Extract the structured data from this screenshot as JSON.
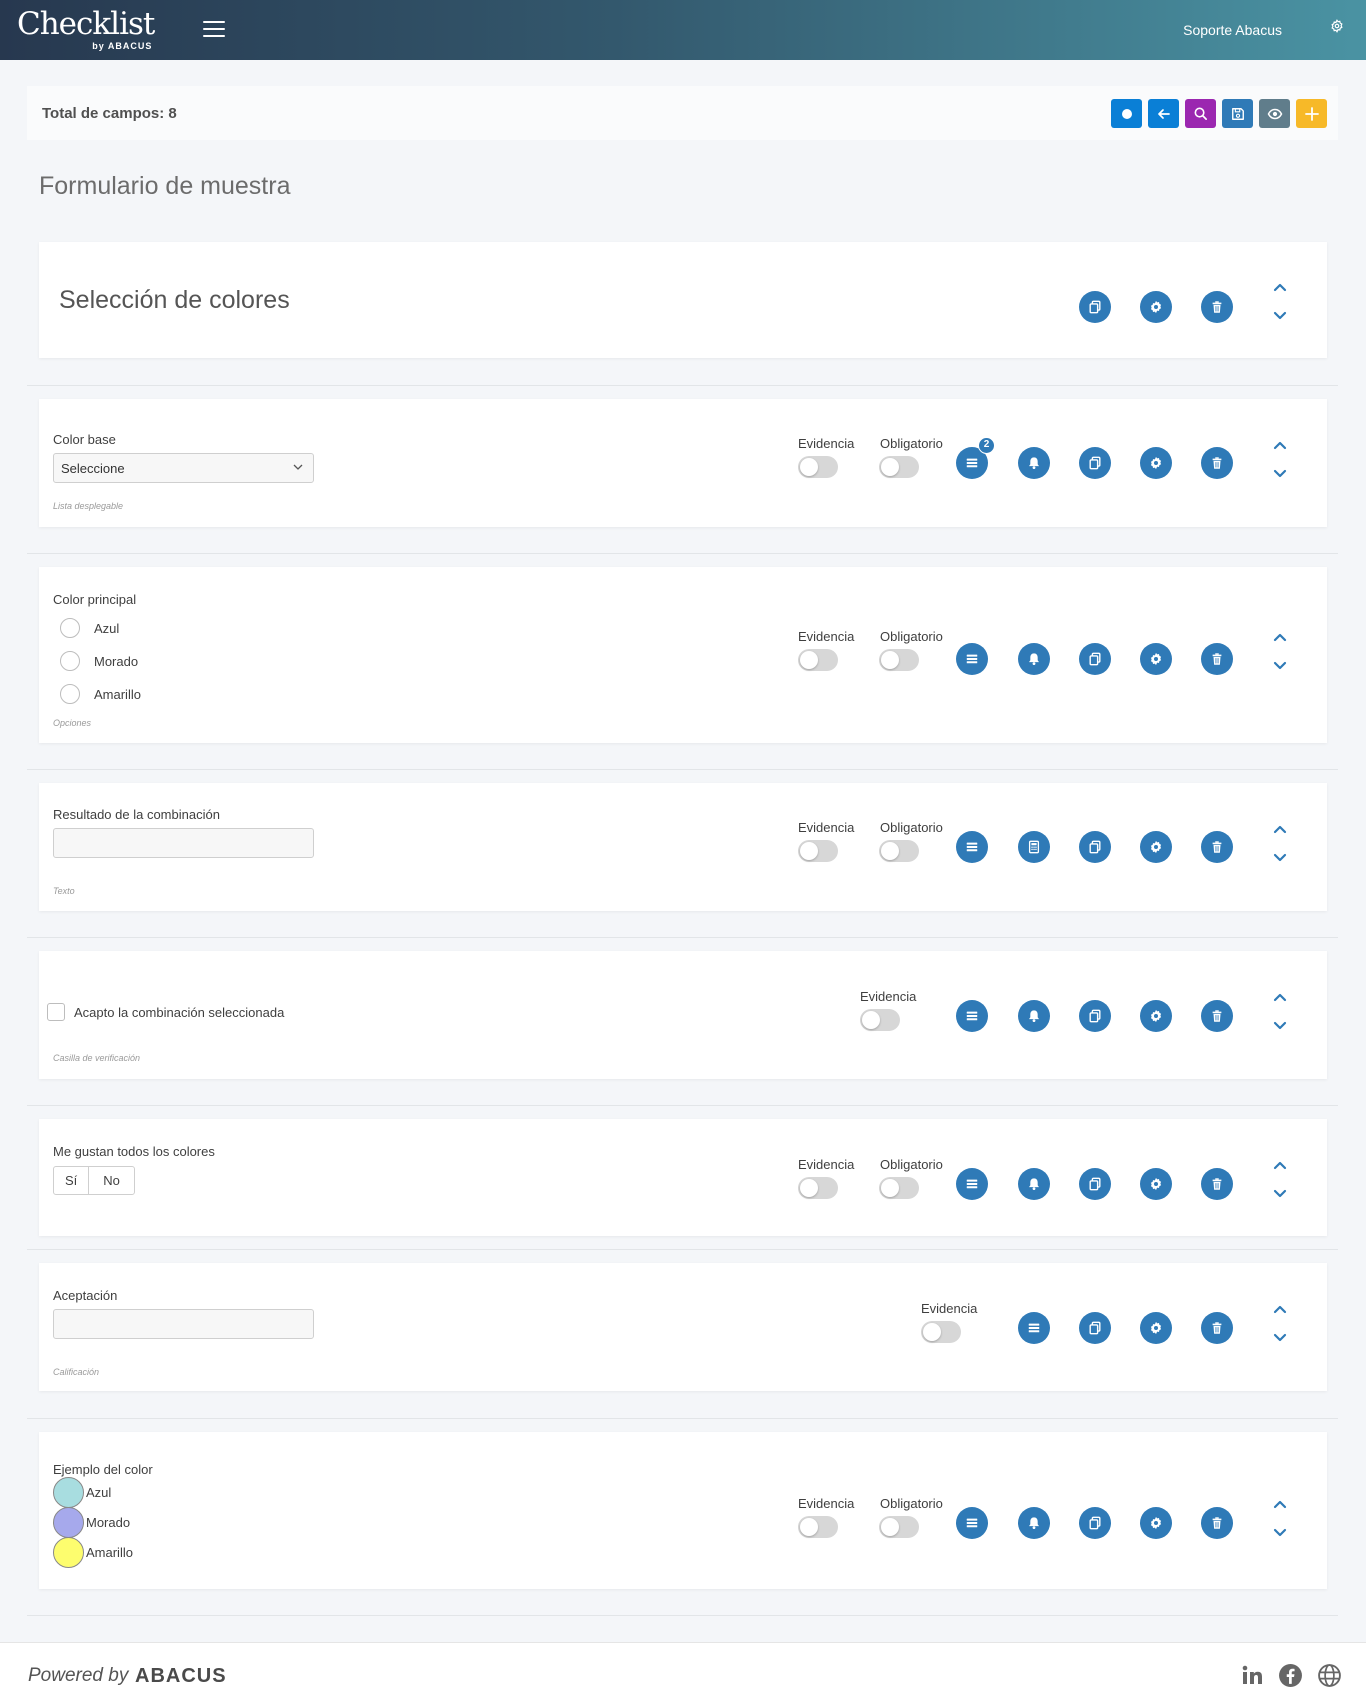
{
  "header": {
    "logo_main": "Checklist",
    "logo_sub": "by ABACUS",
    "user_name": "Soporte Abacus"
  },
  "toolbar": {
    "total_fields": "Total de campos: 8",
    "buttons": [
      {
        "name": "record-icon",
        "color": "#0a7fd6"
      },
      {
        "name": "back-arrow-icon",
        "color": "#0a7fd6"
      },
      {
        "name": "search-icon",
        "color": "#9b27b0"
      },
      {
        "name": "save-icon",
        "color": "#2f7ab7"
      },
      {
        "name": "eye-icon",
        "color": "#607d8b"
      },
      {
        "name": "plus-icon",
        "color": "#f7b928"
      }
    ]
  },
  "form": {
    "title": "Formulario de muestra"
  },
  "section": {
    "title": "Selección de colores"
  },
  "labels": {
    "evidencia": "Evidencia",
    "obligatorio": "Obligatorio"
  },
  "fields": [
    {
      "label": "Color base",
      "type_label": "Lista desplegable",
      "select_value": "Seleccione",
      "badge": "2"
    },
    {
      "label": "Color principal",
      "type_label": "Opciones",
      "options": [
        "Azul",
        "Morado",
        "Amarillo"
      ]
    },
    {
      "label": "Resultado de la combinación",
      "type_label": "Texto"
    },
    {
      "label": "Acapto la combinación seleccionada",
      "type_label": "Casilla de verificación"
    },
    {
      "label": "Me gustan todos los colores",
      "type_label": "",
      "yes": "Sí",
      "no": "No"
    },
    {
      "label": "Aceptación",
      "type_label": "Calificación"
    },
    {
      "label": "Ejemplo del color",
      "type_label": "",
      "colors": [
        {
          "label": "Azul",
          "color": "#a8dde0"
        },
        {
          "label": "Morado",
          "color": "#a6a9ec"
        },
        {
          "label": "Amarillo",
          "color": "#fdfd6e"
        }
      ]
    }
  ],
  "footer": {
    "powered": "Powered by",
    "brand": "ABACUS"
  },
  "colors": {
    "action_blue": "#2f7ab7",
    "header_start": "#27384f",
    "header_end": "#4a93a3"
  }
}
